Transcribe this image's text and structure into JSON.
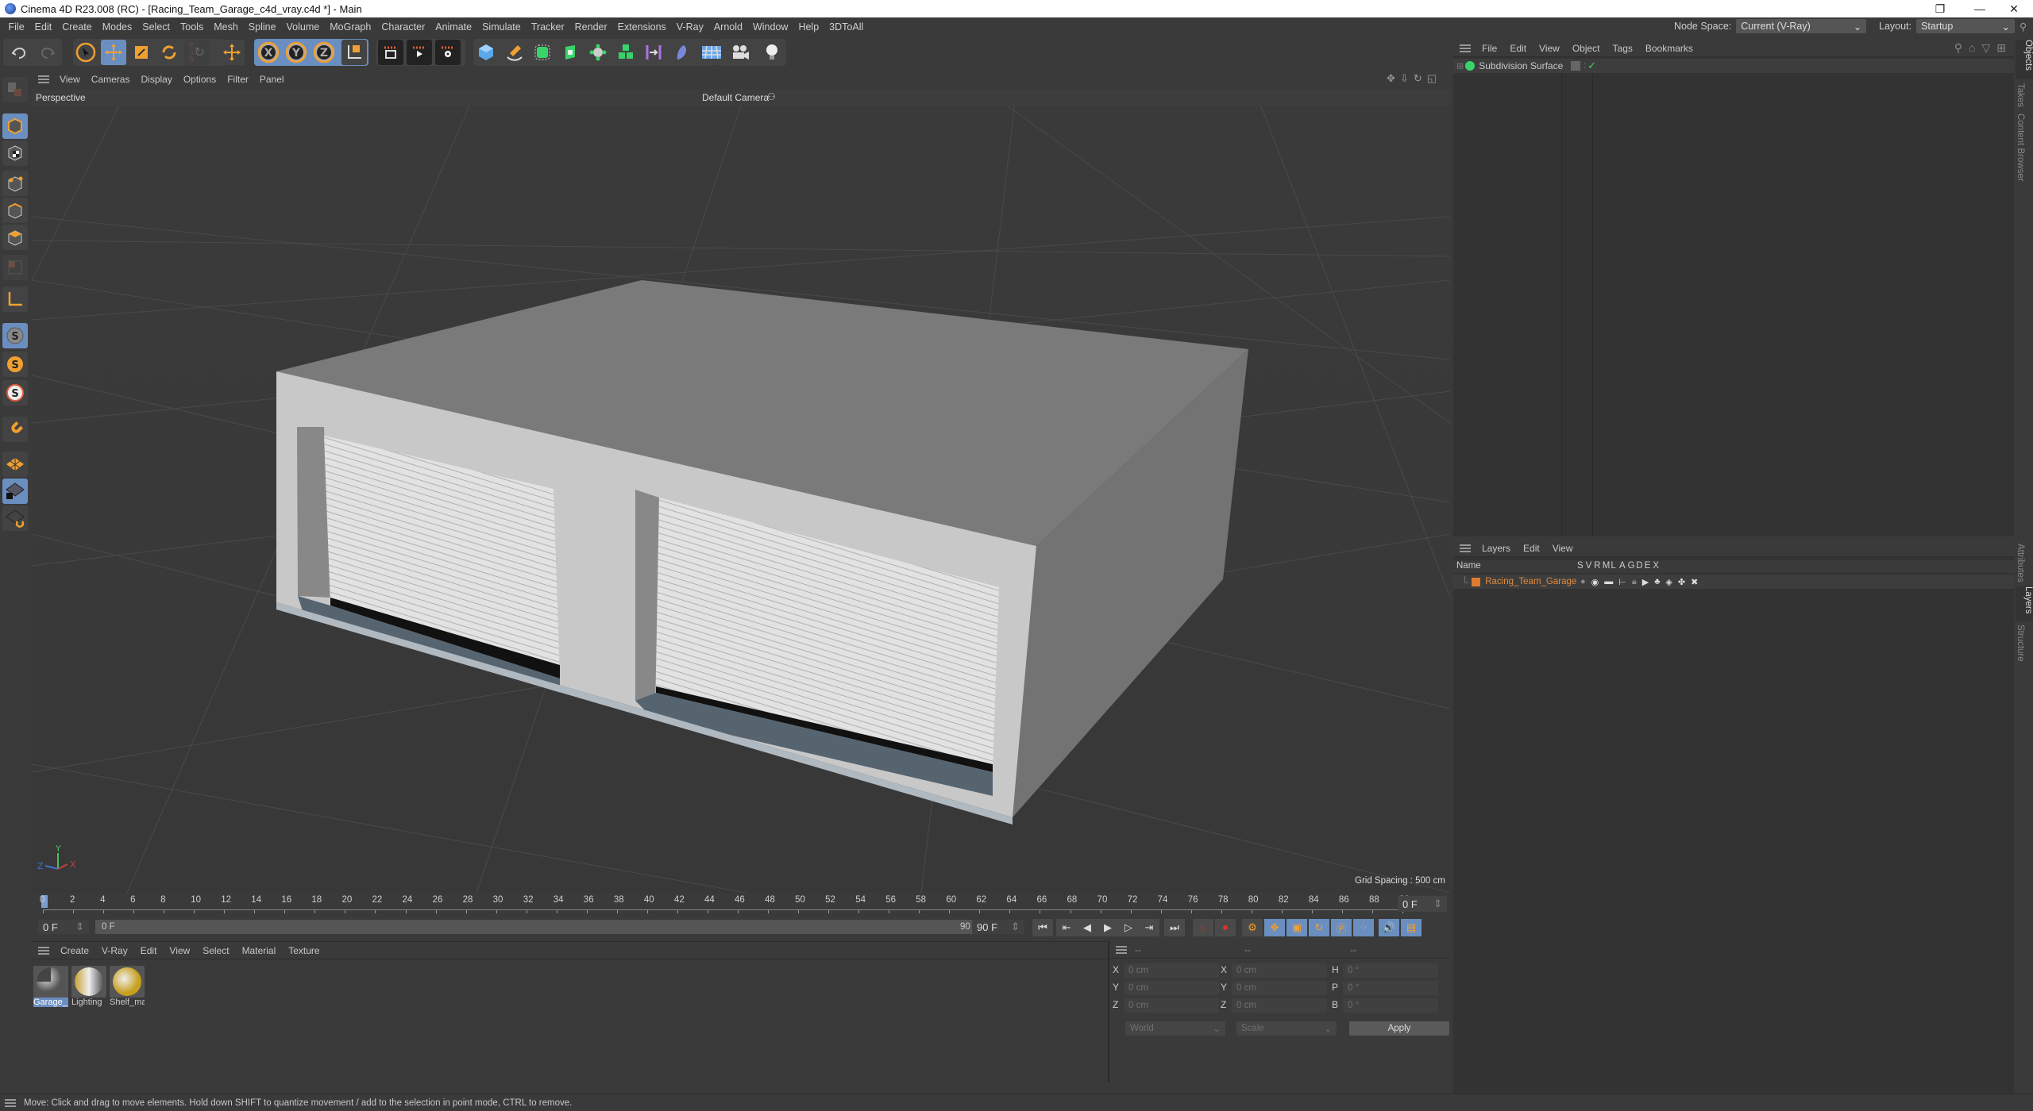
{
  "window": {
    "title": "Cinema 4D R23.008 (RC) - [Racing_Team_Garage_c4d_vray.c4d *] - Main",
    "controls": {
      "minimize": "—",
      "restore": "❐",
      "close": "✕"
    }
  },
  "menubar": {
    "items": [
      "File",
      "Edit",
      "Create",
      "Modes",
      "Select",
      "Tools",
      "Mesh",
      "Spline",
      "Volume",
      "MoGraph",
      "Character",
      "Animate",
      "Simulate",
      "Tracker",
      "Render",
      "Extensions",
      "V-Ray",
      "Arnold",
      "Window",
      "Help",
      "3DToAll"
    ],
    "node_space_label": "Node Space:",
    "node_space_value": "Current (V-Ray)",
    "layout_label": "Layout:",
    "layout_value": "Startup"
  },
  "toolbar": {
    "tools": [
      "undo-icon",
      "redo-icon",
      "select-icon",
      "move-icon",
      "scale-icon",
      "rotate-icon",
      "psr-icon",
      "add-icon",
      "x-axis-icon",
      "y-axis-icon",
      "z-axis-icon",
      "coordinate-system-icon",
      "render-view-icon",
      "render-icon",
      "render-settings-icon",
      "cube-icon",
      "pen-icon",
      "subdivision-icon",
      "extrude-icon",
      "mograph-cloner-icon",
      "boole-icon",
      "deformer-icon",
      "field-icon",
      "floor-icon",
      "camera-icon",
      "light-icon"
    ],
    "axis_labels": {
      "x": "X",
      "y": "Y",
      "z": "Z"
    }
  },
  "left_tools": [
    "make-editable-icon",
    "model-mode-icon",
    "texture-mode-icon",
    "point-mode-icon",
    "edge-mode-icon",
    "polygon-mode-icon",
    "uv-mode-icon",
    "axis-mode-icon",
    "solo-off-icon",
    "solo-icon",
    "solo-hierarchy-icon",
    "snap-icon",
    "workplane-icon",
    "locked-workplane-icon",
    "workplane-align-icon"
  ],
  "viewport": {
    "menu": [
      "View",
      "Cameras",
      "Display",
      "Options",
      "Filter",
      "Panel"
    ],
    "view_name": "Perspective",
    "camera": "Default Camera",
    "grid_spacing": "Grid Spacing : 500 cm",
    "axis": {
      "x": "X",
      "y": "Y",
      "z": "Z"
    }
  },
  "timeline": {
    "ticks": [
      "0",
      "2",
      "4",
      "6",
      "8",
      "10",
      "12",
      "14",
      "16",
      "18",
      "20",
      "22",
      "24",
      "26",
      "28",
      "30",
      "32",
      "34",
      "36",
      "38",
      "40",
      "42",
      "44",
      "46",
      "48",
      "50",
      "52",
      "54",
      "56",
      "58",
      "60",
      "62",
      "64",
      "66",
      "68",
      "70",
      "72",
      "74",
      "76",
      "78",
      "80",
      "82",
      "84",
      "86",
      "88",
      "90"
    ],
    "current_frame_right": "0 F",
    "start_field": "0 F",
    "range_start": "0 F",
    "range_end": "90 F",
    "end_field": "90 F"
  },
  "materials": {
    "menu": [
      "Create",
      "V-Ray",
      "Edit",
      "View",
      "Select",
      "Material",
      "Texture"
    ],
    "items": [
      {
        "name": "Garage_",
        "selected": true
      },
      {
        "name": "Lighting",
        "selected": false
      },
      {
        "name": "Shelf_ma",
        "selected": false
      }
    ]
  },
  "coordinates": {
    "headers": [
      "--",
      "--",
      "--"
    ],
    "rows": [
      {
        "l1": "X",
        "v1": "0 cm",
        "l2": "X",
        "v2": "0 cm",
        "l3": "H",
        "v3": "0 °"
      },
      {
        "l1": "Y",
        "v1": "0 cm",
        "l2": "Y",
        "v2": "0 cm",
        "l3": "P",
        "v3": "0 °"
      },
      {
        "l1": "Z",
        "v1": "0 cm",
        "l2": "Z",
        "v2": "0 cm",
        "l3": "B",
        "v3": "0 °"
      }
    ],
    "mode": "World",
    "transform": "Scale",
    "apply": "Apply"
  },
  "objects": {
    "menu": [
      "File",
      "Edit",
      "View",
      "Object",
      "Tags",
      "Bookmarks"
    ],
    "items": [
      {
        "name": "Subdivision Surface",
        "color": "#38d46a"
      }
    ]
  },
  "layers": {
    "menu": [
      "Layers",
      "Edit",
      "View"
    ],
    "columns": [
      "Name",
      "S",
      "V",
      "R",
      "M",
      "L",
      "A",
      "G",
      "D",
      "E",
      "X"
    ],
    "items": [
      {
        "name": "Racing_Team_Garage",
        "color": "#e07a2e"
      }
    ]
  },
  "side_tabs_top": [
    "Objects",
    "Takes",
    "Content Browser"
  ],
  "side_tabs_bottom": [
    "Attributes",
    "Layers",
    "Structure"
  ],
  "status": "Move: Click and drag to move elements. Hold down SHIFT to quantize movement / add to the selection in point mode, CTRL to remove.",
  "colors": {
    "accent_blue": "#6b8ec0",
    "orange": "#f0a030",
    "layer_orange": "#e07a2e"
  }
}
